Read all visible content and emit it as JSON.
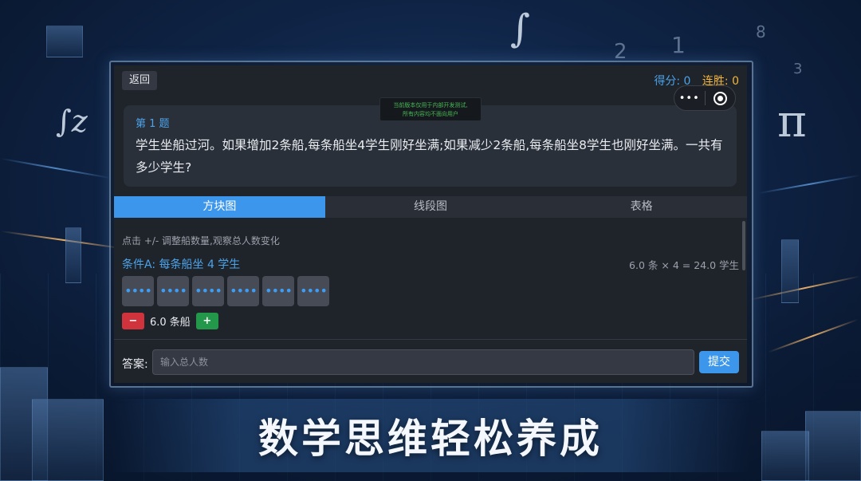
{
  "topbar": {
    "back_label": "返回",
    "score_text": "得分: 0",
    "streak_text": "连胜: 0",
    "capsule_more": "•••",
    "capsule_record_icon": "record-circle-icon"
  },
  "notice": {
    "line1": "当前版本仅用于内部开发测试,",
    "line2": "所有内容均不面向用户"
  },
  "question": {
    "number": "第 1 题",
    "text": "学生坐船过河。如果增加2条船,每条船坐4学生刚好坐满;如果减少2条船,每条船坐8学生也刚好坐满。一共有多少学生?"
  },
  "tabs": [
    {
      "label": "方块图",
      "active": true
    },
    {
      "label": "线段图",
      "active": false
    },
    {
      "label": "表格",
      "active": false
    }
  ],
  "block_view": {
    "hint": "点击 +/- 调整船数量,观察总人数变化",
    "condition_label": "条件A: 每条船坐 4 学生",
    "condition_calc": "6.0 条 × 4 = 24.0 学生",
    "boat_dots": "••••",
    "boat_count": 6,
    "minus_label": "−",
    "plus_label": "+",
    "boats_value": "6.0 条船"
  },
  "answer": {
    "label": "答案:",
    "placeholder": "输入总人数",
    "submit_label": "提交"
  },
  "decor": {
    "slogan": "数学思维轻松养成",
    "sym_integral_top": "∫",
    "sym_integral_left": "∫z",
    "sym_pi": "π",
    "digits_a": "2",
    "digits_b": "1",
    "digits_c": "8",
    "digits_d": "3"
  },
  "colors": {
    "accent": "#3c96eb",
    "score": "#4ba3ea",
    "streak": "#f1b53c",
    "minus": "#d1333d",
    "plus": "#24984a"
  }
}
